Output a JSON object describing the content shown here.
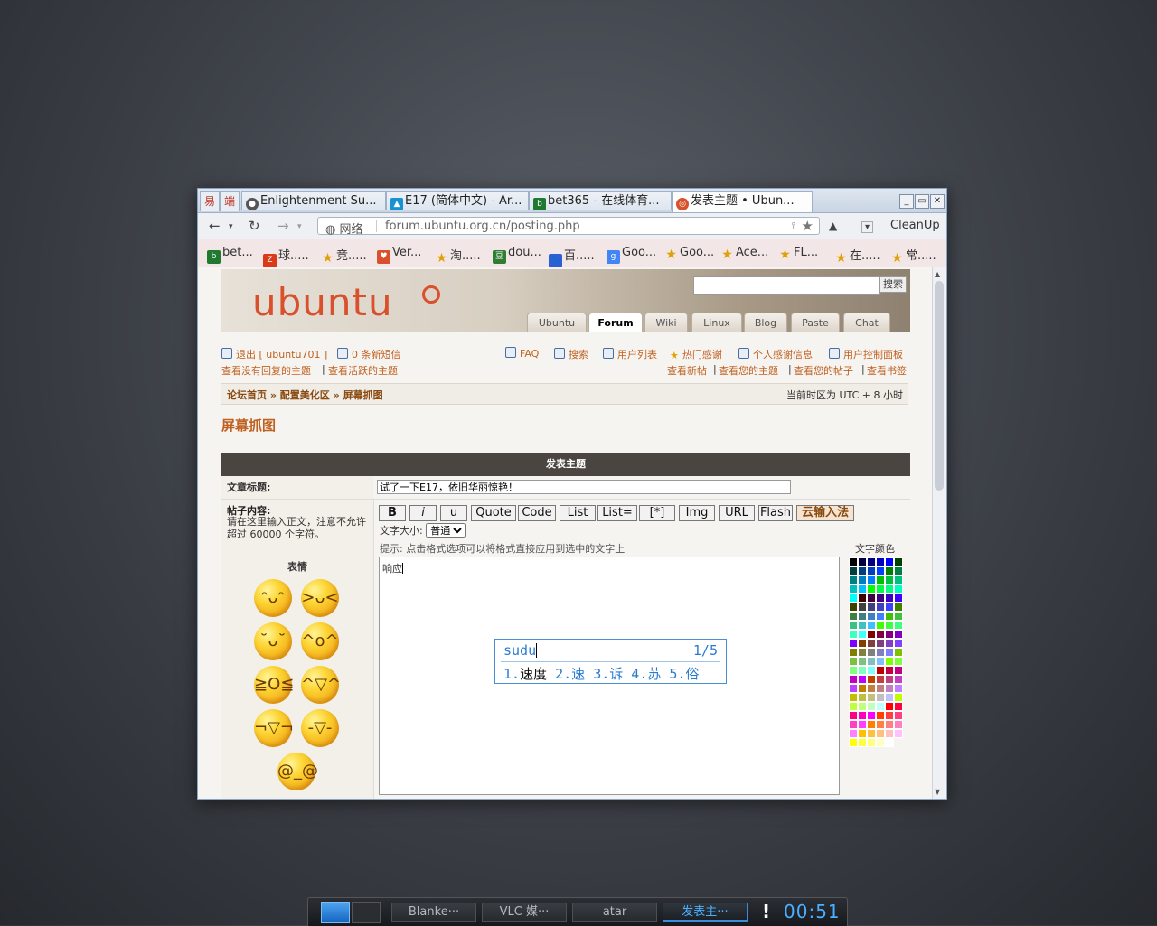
{
  "browser": {
    "pinned_tabs": [
      "易",
      "端"
    ],
    "tabs": [
      {
        "title": "Enlightenment Su..."
      },
      {
        "title": "E17 (简体中文) - Ar..."
      },
      {
        "title": "bet365 - 在线体育..."
      },
      {
        "title": "发表主题 • Ubun..."
      }
    ],
    "window_buttons": [
      "_",
      "▭",
      "✕"
    ],
    "nav": {
      "back": "←",
      "reload": "↻",
      "forward": "→"
    },
    "url_label": "网络",
    "url": "forum.ubuntu.org.cn/posting.php",
    "up_arrow": "▲",
    "cleanup": "CleanUp"
  },
  "bookmarks": [
    {
      "label": "bet...",
      "icon": "bet365-icon",
      "color": "#1f7a2f"
    },
    {
      "label": "球.....",
      "icon": "z-icon",
      "color": "#d93a1a"
    },
    {
      "label": "竞.....",
      "icon": "star-icon",
      "color": "#e0a000"
    },
    {
      "label": "Ver...",
      "icon": "heart-icon",
      "color": "#d9512c"
    },
    {
      "label": "淘.....",
      "icon": "star-icon",
      "color": "#e0a000"
    },
    {
      "label": "dou...",
      "icon": "douban-icon",
      "color": "#2e7d32"
    },
    {
      "label": "百.....",
      "icon": "baidu-icon",
      "color": "#2d5fd6"
    },
    {
      "label": "Goo...",
      "icon": "google-icon",
      "color": "#4285f4"
    },
    {
      "label": "Goo...",
      "icon": "star-icon",
      "color": "#e0a000"
    },
    {
      "label": "Ace...",
      "icon": "star-icon",
      "color": "#e0a000"
    },
    {
      "label": "FL...",
      "icon": "star-icon",
      "color": "#e0a000"
    },
    {
      "label": "在.....",
      "icon": "star-icon",
      "color": "#e0a000"
    },
    {
      "label": "常.....",
      "icon": "star-icon",
      "color": "#e0a000"
    }
  ],
  "site": {
    "logo": "ubuntu",
    "search_button": "搜索",
    "tabs": [
      "Ubuntu",
      "Forum",
      "Wiki",
      "Linux",
      "Blog",
      "Paste",
      "Chat"
    ],
    "logout": "退出 [ ubuntu701 ]",
    "messages": "0 条新短信",
    "faq": "FAQ",
    "search": "搜索",
    "memberlist": "用户列表",
    "hot_thanks": "热门感谢",
    "thanks_info": "个人感谢信息",
    "ucp": "用户控制面板",
    "unanswered": "查看没有回复的主题",
    "active": "查看活跃的主题",
    "new_posts": "查看新帖",
    "your_topics": "查看您的主题",
    "your_posts": "查看您的帖子",
    "bookmarks": "查看书签",
    "breadcrumb_1": "论坛首页",
    "breadcrumb_2": "配置美化区",
    "breadcrumb_3": "屏幕抓图",
    "sep": "»",
    "timezone": "当前时区为 UTC + 8 小时",
    "forum_title": "屏幕抓图"
  },
  "post": {
    "header": "发表主题",
    "subject_label": "文章标题:",
    "subject_value": "试了一下E17，依旧华丽惊艳！",
    "body_label": "帖子内容:",
    "body_desc": "请在这里输入正文，注意不允许超过 60000 个字符。",
    "emoticons_label": "表情",
    "buttons": [
      "B",
      "i",
      "u",
      "Quote",
      "Code",
      "List",
      "List=",
      "[*]",
      "Img",
      "URL",
      "Flash",
      "云输入法"
    ],
    "font_size_label": "文字大小:",
    "font_size_value": "普通",
    "hint": "提示: 点击格式选项可以将格式直接应用到选中的文字上",
    "body_text": "响应",
    "color_label": "文字颜色"
  },
  "ime": {
    "input": "sudu",
    "page": "1/5",
    "c1": "1.",
    "c1h": "速度",
    "rest": " 2.速 3.诉 4.苏 5.俗"
  },
  "taskbar": {
    "items": [
      "Blanke···",
      "VLC 媒···",
      "atar",
      "发表主···"
    ],
    "clock": "00:51",
    "warn": "!"
  }
}
